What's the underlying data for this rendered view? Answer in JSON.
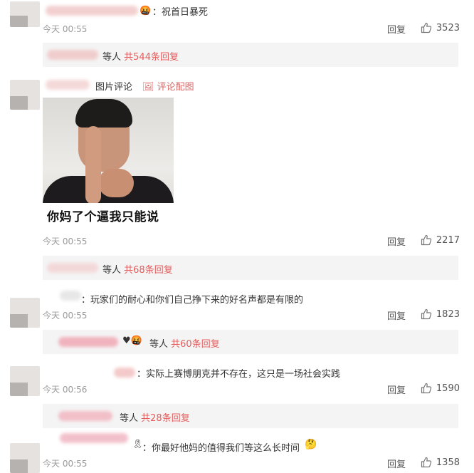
{
  "comments": [
    {
      "text": "：祝首日暴死",
      "time": "今天 00:55",
      "reply": "回复",
      "likes": "3523",
      "sub_tail": "等人",
      "sub_count": "共544条回复"
    },
    {
      "tag": "图片评论",
      "tag_link": "评论配图",
      "image_caption": "你妈了个逼我只能说",
      "time": "今天 00:55",
      "reply": "回复",
      "likes": "2217",
      "sub_tail": "等人",
      "sub_count": "共68条回复"
    },
    {
      "text": "：玩家们的耐心和你们自己挣下来的好名声都是有限的",
      "time": "今天 00:55",
      "reply": "回复",
      "likes": "1823",
      "sub_tail": "等人",
      "sub_count": "共60条回复"
    },
    {
      "text": "：实际上赛博朋克并不存在，这只是一场社会实践",
      "time": "今天 00:56",
      "reply": "回复",
      "likes": "1590",
      "sub_tail": "等人",
      "sub_count": "共28条回复"
    },
    {
      "text": "：你最好他妈的值得我们等这么长时间",
      "time": "今天 00:55",
      "reply": "回复",
      "likes": "1358"
    }
  ],
  "colors": {
    "count_red": "#e75c5c",
    "link_red": "#d96a6a",
    "muted": "#9a9a9a"
  }
}
